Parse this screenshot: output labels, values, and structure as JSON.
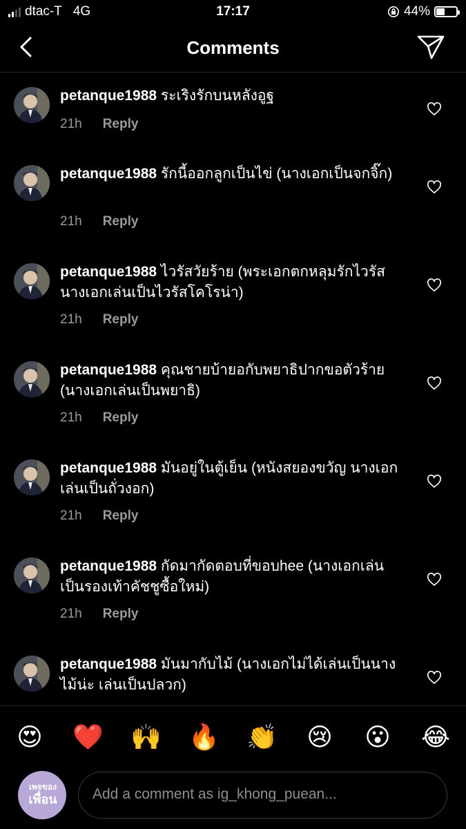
{
  "status_bar": {
    "carrier": "dtac-T",
    "network": "4G",
    "time": "17:17",
    "battery": "44%",
    "battery_level": 0.44
  },
  "header": {
    "title": "Comments",
    "back_icon": "chevron-left-icon",
    "send_icon": "paper-plane-icon"
  },
  "comments": [
    {
      "username": "petanque1988",
      "text": "ระเริงรักบนหลังอูฐ",
      "time": "21h",
      "reply_label": "Reply"
    },
    {
      "username": "petanque1988",
      "text": "รักนี้ออกลูกเป็นไข่ (นางเอกเป็นจกจิ๊ก)",
      "time": "21h",
      "reply_label": "Reply"
    },
    {
      "username": "petanque1988",
      "text": "ไวรัสวัยร้าย (พระเอกตกหลุมรักไวรัส นางเอกเล่นเป็นไวรัสโคโรน่า)",
      "time": "21h",
      "reply_label": "Reply"
    },
    {
      "username": "petanque1988",
      "text": "คุณชายบ้ายอกับพยาธิปากขอตัวร้าย (นางเอกเล่นเป็นพยาธิ)",
      "time": "21h",
      "reply_label": "Reply"
    },
    {
      "username": "petanque1988",
      "text": "มันอยู่ในตู้เย็น (หนังสยองขวัญ นางเอกเล่นเป็นถั่วงอก)",
      "time": "21h",
      "reply_label": "Reply"
    },
    {
      "username": "petanque1988",
      "text": "กัดมากัดตอบที่ขอบhee (นางเอกเล่นเป็นรองเท้าคัชชูซื้อใหม่)",
      "time": "21h",
      "reply_label": "Reply"
    },
    {
      "username": "petanque1988",
      "text": "มันมากับไม้ (นางเอกไม่ได้เล่นเป็นนางไม้น่ะ เล่นเป็นปลวก)",
      "time": "",
      "reply_label": ""
    }
  ],
  "emoji_bar": [
    "😍",
    "❤️",
    "🙌",
    "🔥",
    "👏",
    "😢",
    "😮",
    "😂"
  ],
  "compose": {
    "page_avatar_small": "เพจของ",
    "page_avatar_big": "เพื่อน",
    "placeholder": "Add a comment as ig_khong_puean..."
  },
  "colors": {
    "background": "#000000",
    "secondary_text": "#9a9a9a",
    "divider": "#262626",
    "page_avatar": "#b8a8d8"
  }
}
